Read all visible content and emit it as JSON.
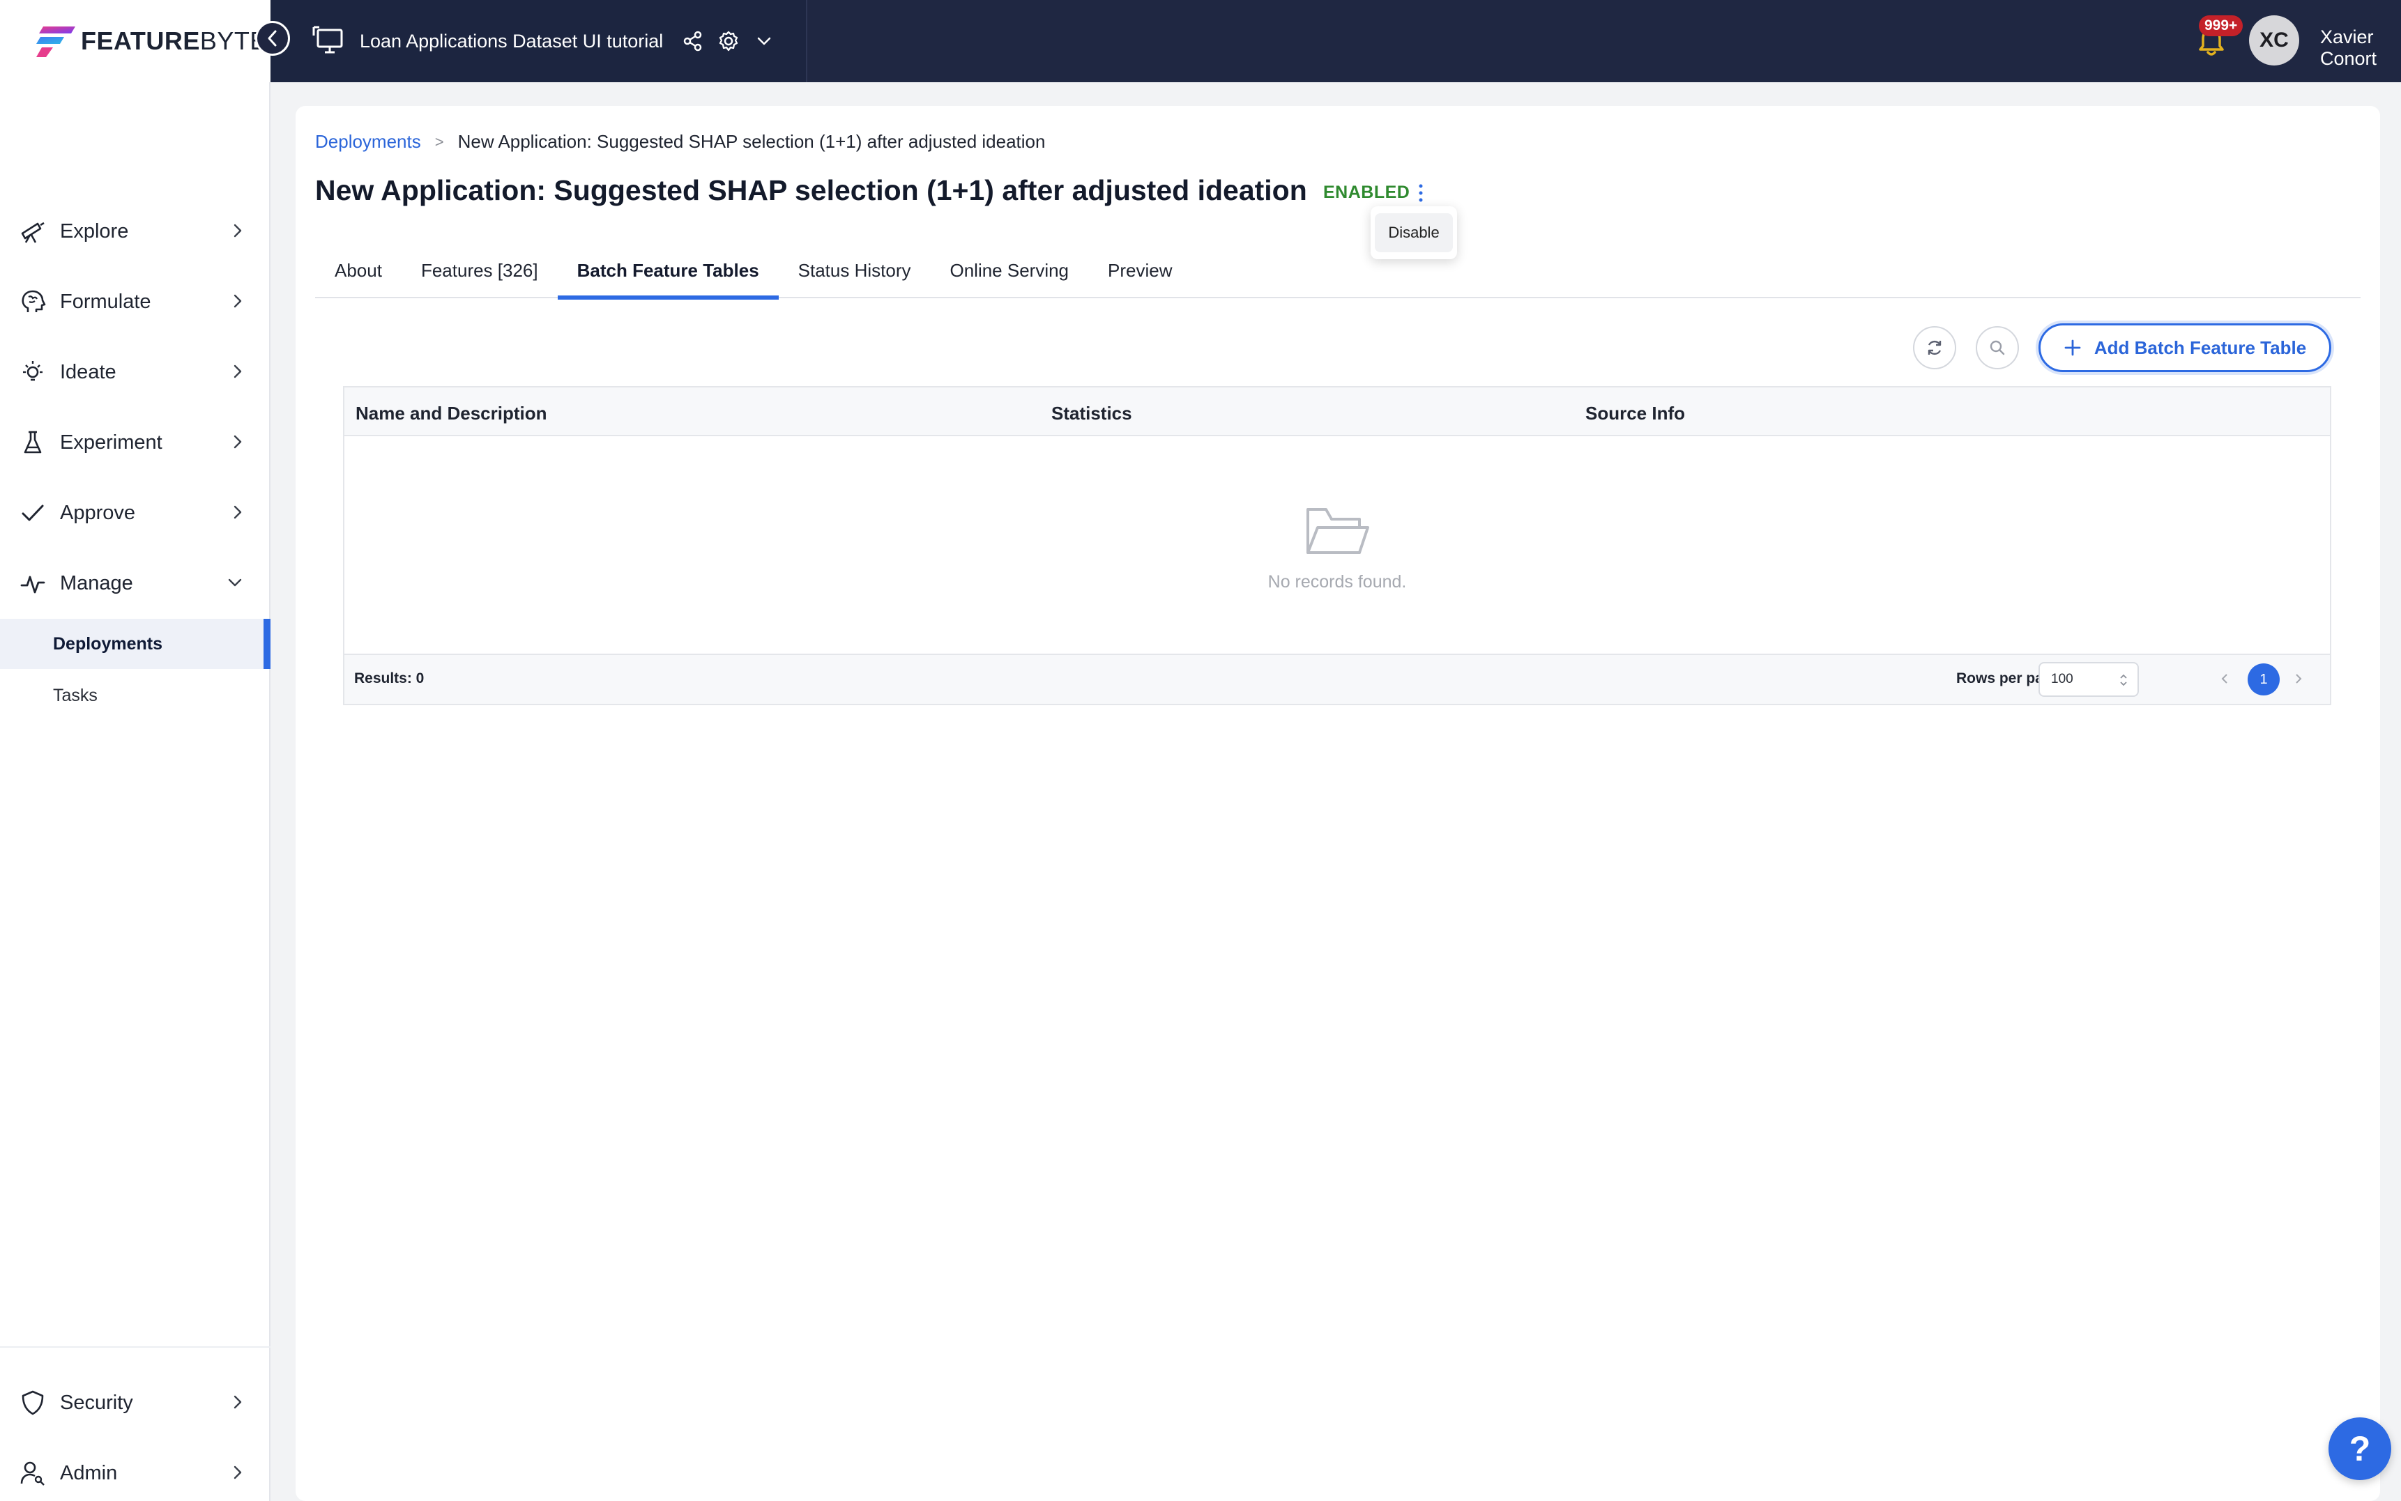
{
  "brand": {
    "name_bold": "FEATURE",
    "name_light": "BYTE"
  },
  "project": {
    "name": "Loan Applications Dataset UI tutorial"
  },
  "user": {
    "initials": "XC",
    "name": "Xavier Conort",
    "notifications": "999+"
  },
  "sidebar": {
    "items": [
      {
        "label": "Explore",
        "icon": "telescope-icon"
      },
      {
        "label": "Formulate",
        "icon": "brain-icon"
      },
      {
        "label": "Ideate",
        "icon": "lightbulb-icon"
      },
      {
        "label": "Experiment",
        "icon": "flask-icon"
      },
      {
        "label": "Approve",
        "icon": "check-icon"
      },
      {
        "label": "Manage",
        "icon": "activity-icon"
      }
    ],
    "manage_sub": [
      {
        "label": "Deployments",
        "active": true
      },
      {
        "label": "Tasks",
        "active": false
      }
    ],
    "bottom_items": [
      {
        "label": "Security",
        "icon": "shield-icon"
      },
      {
        "label": "Admin",
        "icon": "user-key-icon"
      }
    ]
  },
  "breadcrumb": {
    "parent": "Deployments",
    "separator": ">",
    "current": "New Application: Suggested SHAP selection (1+1) after adjusted ideation"
  },
  "page": {
    "title": "New Application: Suggested SHAP selection (1+1) after adjusted ideation",
    "status": "ENABLED",
    "menu_action": "Disable"
  },
  "tabs": [
    {
      "label": "About",
      "active": false
    },
    {
      "label": "Features [326]",
      "active": false
    },
    {
      "label": "Batch Feature Tables",
      "active": true
    },
    {
      "label": "Status History",
      "active": false
    },
    {
      "label": "Online Serving",
      "active": false
    },
    {
      "label": "Preview",
      "active": false
    }
  ],
  "toolbar": {
    "add_label": "Add Batch Feature Table"
  },
  "table": {
    "columns": [
      "Name and Description",
      "Statistics",
      "Source Info"
    ],
    "empty_message": "No records found.",
    "results_label": "Results: 0",
    "rows_per_page_label": "Rows per page:",
    "rows_per_page_value": "100",
    "current_page": "1"
  },
  "help": {
    "label": "?"
  },
  "colors": {
    "accent": "#2d6ae3",
    "header_dark": "#1c2540",
    "status_enabled": "#2f8a2f",
    "badge_red": "#c42129"
  }
}
